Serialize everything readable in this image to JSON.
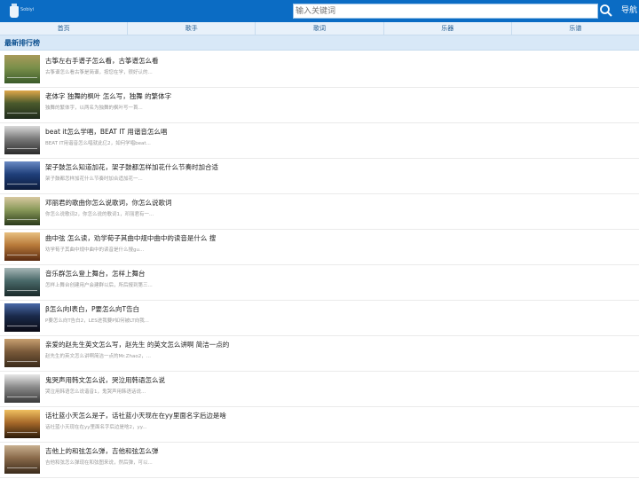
{
  "header": {
    "logo_text": "Sobiyi",
    "search_placeholder": "输入关键词",
    "nav_label": "导航"
  },
  "menu": [
    "首页",
    "歌手",
    "歌词",
    "乐器",
    "乐谱"
  ],
  "section_title": "最新排行榜",
  "items": [
    {
      "title": "古筝左右手谱子怎么看，古筝谱怎么看",
      "desc": "古筝谱怎么看古筝是简谱，按您在学，很好认的...",
      "thumb": [
        "#3a5a2a",
        "#7a8f4a",
        "#a89a5a"
      ]
    },
    {
      "title": "老体字 独舞的枫叶 怎么写，独舞 的繁体字",
      "desc": "独舞的繁体字，以两名为独舞的枫叶写一首...",
      "thumb": [
        "#1e2a1c",
        "#4a5a2c",
        "#e0a84a"
      ]
    },
    {
      "title": "beat it怎么学唱，BEAT IT 用谐音怎么唱",
      "desc": "BEAT IT用谐音怎么唱就此亿2，如何学唱beat...",
      "thumb": [
        "#2a2a2a",
        "#7a7a7a",
        "#d8d8d8"
      ]
    },
    {
      "title": "架子鼓怎么知道加花，架子鼓都怎样加花什么节奏时加合适",
      "desc": "架子鼓都怎样加花什么节奏时加合适加花一...",
      "thumb": [
        "#0c1b3a",
        "#1f3f7a",
        "#6a8ac4"
      ]
    },
    {
      "title": "邓丽君的歌曲你怎么说歌词，你怎么说歌词",
      "desc": "你怎么说歌词2，你怎么说的歌词1，邓丽君有一...",
      "thumb": [
        "#2a3a1a",
        "#8a9a5a",
        "#d8c8a0"
      ]
    },
    {
      "title": "曲中弦 怎么读，劝学荀子其曲中规中曲中的读音是什么 搜",
      "desc": "劝学荀子其曲中规中曲中的读音是什么搜gu...",
      "thumb": [
        "#5a2a10",
        "#b87a3a",
        "#e8c080"
      ]
    },
    {
      "title": "音乐群怎么登上舞台，怎样上舞台",
      "desc": "怎样上舞台创建用户会建群以后，所后报到第三...",
      "thumb": [
        "#1a2a2a",
        "#4a6a6a",
        "#a8b8b8"
      ]
    },
    {
      "title": "β怎么向I表白，P要怎么向T告白",
      "desc": "P要怎么向T告白2，LES进我要P如何被LT向我...",
      "thumb": [
        "#0a0a14",
        "#1a2a4a",
        "#4a6aa8"
      ]
    },
    {
      "title": "亲爱的赵先生英文怎么写，赵先生 的英文怎么讲啊 简洁一点的",
      "desc": "赵先生的英文怎么讲啊简洁一点的Mr.Zhao2，...",
      "thumb": [
        "#3a2a1a",
        "#7a5a3a",
        "#c8a070"
      ]
    },
    {
      "title": "鬼哭声用韩文怎么说，哭泣用韩语怎么说",
      "desc": "哭泣用韩语怎么说谐音1，鬼哭声用韩语话说...",
      "thumb": [
        "#3a3a3a",
        "#8a8a8a",
        "#e8e8e8"
      ]
    },
    {
      "title": "话社蓝小天怎么是子，话社蓝小天现在在yy里面名字后边是啥",
      "desc": "话社蓝小天现在在yy里面名字后边是啥2，yy...",
      "thumb": [
        "#2a1a0a",
        "#a86a2a",
        "#f0c060"
      ]
    },
    {
      "title": "吉他上的和弦怎么弹，吉他和弦怎么弹",
      "desc": "吉他和弦怎么弹现在和弦图来说，然后弹，可以...",
      "thumb": [
        "#3a2a1a",
        "#8a6a4a",
        "#c8b090"
      ]
    }
  ]
}
